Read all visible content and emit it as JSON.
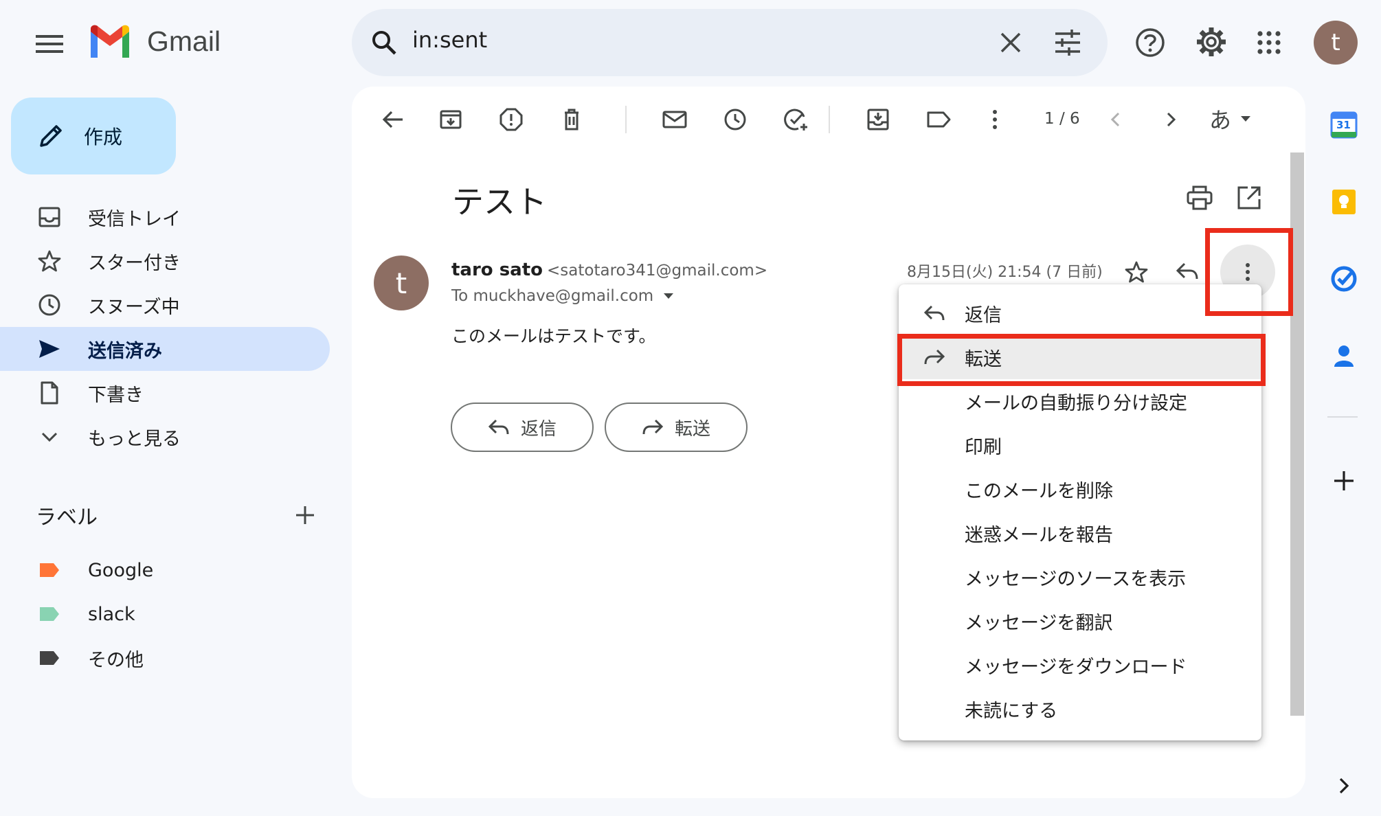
{
  "header": {
    "app_name": "Gmail",
    "search_value": "in:sent",
    "avatar_letter": "t"
  },
  "sidebar": {
    "compose_label": "作成",
    "items": [
      {
        "label": "受信トレイ",
        "icon": "inbox-icon"
      },
      {
        "label": "スター付き",
        "icon": "star-icon"
      },
      {
        "label": "スヌーズ中",
        "icon": "clock-icon"
      },
      {
        "label": "送信済み",
        "icon": "send-icon",
        "active": true
      },
      {
        "label": "下書き",
        "icon": "draft-icon"
      },
      {
        "label": "もっと見る",
        "icon": "chevron-down-icon"
      }
    ],
    "labels_title": "ラベル",
    "labels": [
      {
        "name": "Google",
        "color": "#ff7537"
      },
      {
        "name": "slack",
        "color": "#89d3b2"
      },
      {
        "name": "その他",
        "color": "#434343"
      }
    ]
  },
  "toolbar": {
    "page_count": "1 / 6",
    "input_tool": "あ"
  },
  "message": {
    "subject": "テスト",
    "sender_name": "taro sato",
    "sender_email": "<satotaro341@gmail.com>",
    "to": "To muckhave@gmail.com",
    "date": "8月15日(火) 21:54 (7 日前)",
    "body": "このメールはテストです。",
    "avatar_letter": "t",
    "reply_label": "返信",
    "forward_label": "転送"
  },
  "menu": {
    "items": [
      {
        "label": "返信",
        "icon": "reply-icon"
      },
      {
        "label": "転送",
        "icon": "forward-icon",
        "highlighted": true
      },
      {
        "label": "メールの自動振り分け設定"
      },
      {
        "label": "印刷"
      },
      {
        "label": "このメールを削除"
      },
      {
        "label": "迷惑メールを報告"
      },
      {
        "label": "メッセージのソースを表示"
      },
      {
        "label": "メッセージを翻訳"
      },
      {
        "label": "メッセージをダウンロード"
      },
      {
        "label": "未読にする"
      }
    ]
  },
  "side_panel": {
    "calendar_day": "31"
  },
  "colors": {
    "accent_blue": "#0b57d0",
    "highlight_red": "#ea2c1b",
    "compose_bg": "#c2e7ff",
    "active_nav_bg": "#d3e3fd"
  }
}
